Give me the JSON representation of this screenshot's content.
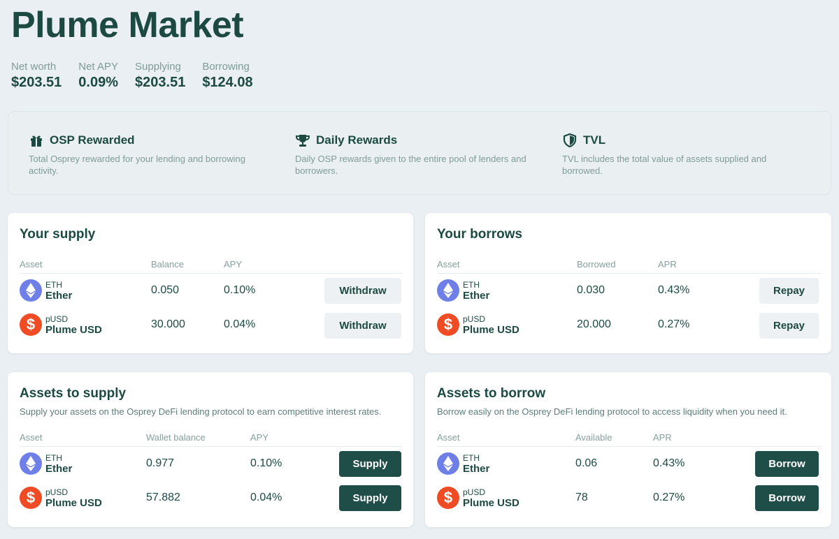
{
  "page": {
    "title": "Plume Market"
  },
  "stats": [
    {
      "label": "Net worth",
      "value": "$203.51"
    },
    {
      "label": "Net APY",
      "value": "0.09%"
    },
    {
      "label": "Supplying",
      "value": "$203.51"
    },
    {
      "label": "Borrowing",
      "value": "$124.08"
    }
  ],
  "info": [
    {
      "icon": "gift-icon",
      "title": "OSP Rewarded",
      "desc": "Total Osprey rewarded for your lending and borrowing activity."
    },
    {
      "icon": "trophy-icon",
      "title": "Daily Rewards",
      "desc": "Daily OSP rewards given to the entire pool of lenders and borrowers."
    },
    {
      "icon": "shield-icon",
      "title": "TVL",
      "desc": "TVL includes the total value of assets supplied and borrowed."
    }
  ],
  "your_supply": {
    "title": "Your supply",
    "columns": [
      "Asset",
      "Balance",
      "APY"
    ],
    "rows": [
      {
        "symbol": "ETH",
        "name": "Ether",
        "value": "0.050",
        "rate": "0.10%",
        "action": "Withdraw"
      },
      {
        "symbol": "pUSD",
        "name": "Plume USD",
        "value": "30.000",
        "rate": "0.04%",
        "action": "Withdraw"
      }
    ]
  },
  "your_borrows": {
    "title": "Your borrows",
    "columns": [
      "Asset",
      "Borrowed",
      "APR"
    ],
    "rows": [
      {
        "symbol": "ETH",
        "name": "Ether",
        "value": "0.030",
        "rate": "0.43%",
        "action": "Repay"
      },
      {
        "symbol": "pUSD",
        "name": "Plume USD",
        "value": "20.000",
        "rate": "0.27%",
        "action": "Repay"
      }
    ]
  },
  "assets_to_supply": {
    "title": "Assets to supply",
    "subtitle": "Supply your assets on the Osprey DeFi lending protocol to earn competitive interest rates.",
    "columns": [
      "Asset",
      "Wallet balance",
      "APY"
    ],
    "rows": [
      {
        "symbol": "ETH",
        "name": "Ether",
        "value": "0.977",
        "rate": "0.10%",
        "action": "Supply"
      },
      {
        "symbol": "pUSD",
        "name": "Plume USD",
        "value": "57.882",
        "rate": "0.04%",
        "action": "Supply"
      }
    ]
  },
  "assets_to_borrow": {
    "title": "Assets to borrow",
    "subtitle": "Borrow easily on the Osprey DeFi lending protocol to access liquidity when you need it.",
    "columns": [
      "Asset",
      "Available",
      "APR"
    ],
    "rows": [
      {
        "symbol": "ETH",
        "name": "Ether",
        "value": "0.06",
        "rate": "0.43%",
        "action": "Borrow"
      },
      {
        "symbol": "pUSD",
        "name": "Plume USD",
        "value": "78",
        "rate": "0.27%",
        "action": "Borrow"
      }
    ]
  },
  "colors": {
    "accent": "#1f4d48",
    "eth": "#6e7fe8",
    "pusd": "#ef4b24",
    "background": "#e9eff2"
  }
}
